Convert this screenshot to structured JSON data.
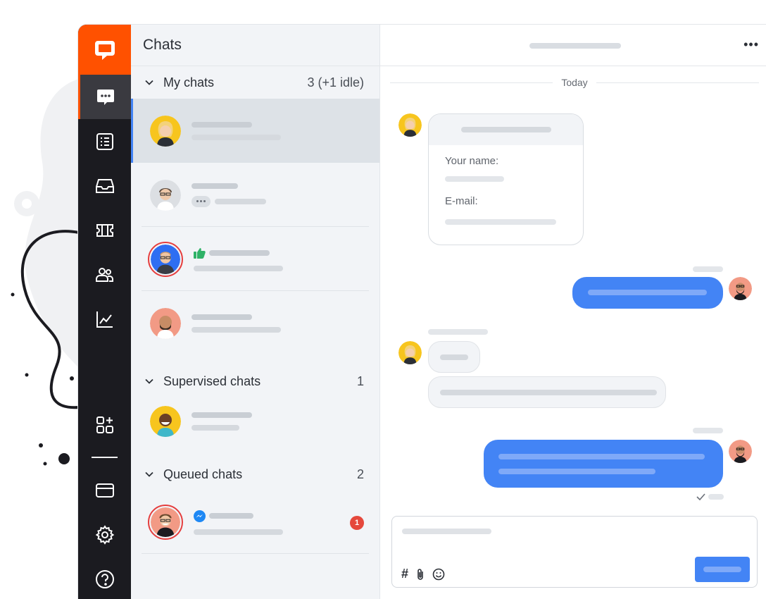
{
  "list": {
    "title": "Chats",
    "sections": {
      "my": {
        "label": "My chats",
        "count": "3 (+1 idle)"
      },
      "supervised": {
        "label": "Supervised chats",
        "count": "1"
      },
      "queued": {
        "label": "Queued chats",
        "count": "2"
      }
    },
    "unread_badge": "1"
  },
  "conversation": {
    "date_separator": "Today",
    "more_label": "•••",
    "form": {
      "name_label": "Your name:",
      "email_label": "E-mail:"
    }
  },
  "composer": {
    "tools": [
      "hashtag-icon",
      "paperclip-icon",
      "emoji-icon"
    ],
    "hashtag": "#"
  },
  "colors": {
    "brand_orange": "#ff5100",
    "rail_dark": "#1b1b20",
    "accent_blue": "#4384f5",
    "badge_red": "#e5483c",
    "thumbs_green": "#2fb267",
    "messenger_blue": "#1e88f4"
  },
  "nav": [
    "chats-icon",
    "list-icon",
    "inbox-icon",
    "ticket-icon",
    "customers-icon",
    "reports-icon",
    "apps-icon",
    "billing-icon",
    "settings-icon",
    "help-icon"
  ]
}
